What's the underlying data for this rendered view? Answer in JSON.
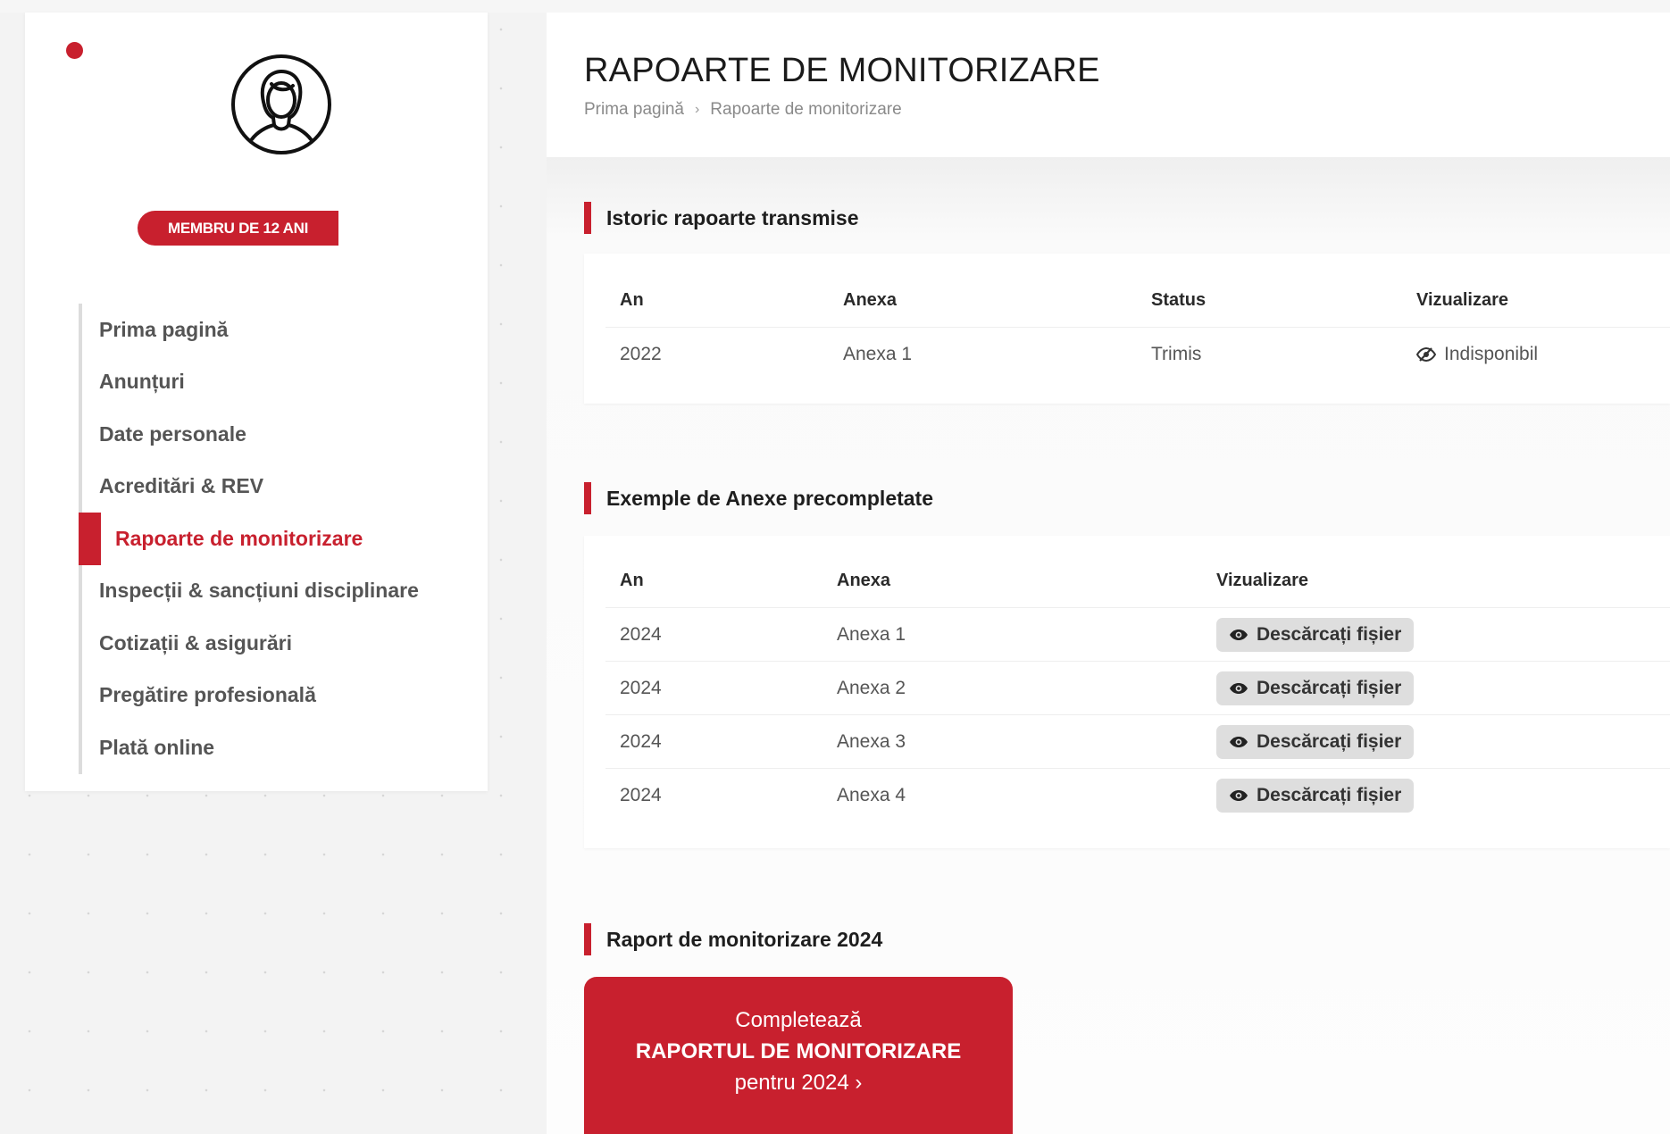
{
  "sidebar": {
    "badge": "MEMBRU DE 12 ANI",
    "items": [
      {
        "label": "Prima pagină",
        "active": false
      },
      {
        "label": "Anunțuri",
        "active": false
      },
      {
        "label": "Date personale",
        "active": false
      },
      {
        "label": "Acreditări & REV",
        "active": false
      },
      {
        "label": "Rapoarte de monitorizare",
        "active": true
      },
      {
        "label": "Inspecții & sancțiuni disciplinare",
        "active": false
      },
      {
        "label": "Cotizații & asigurări",
        "active": false
      },
      {
        "label": "Pregătire profesională",
        "active": false
      },
      {
        "label": "Plată online",
        "active": false
      }
    ]
  },
  "header": {
    "title": "RAPOARTE DE MONITORIZARE",
    "breadcrumb": [
      "Prima pagină",
      "Rapoarte de monitorizare"
    ],
    "breadcrumb_sep": "›"
  },
  "history": {
    "title": "Istoric rapoarte transmise",
    "columns": [
      "An",
      "Anexa",
      "Status",
      "Vizualizare"
    ],
    "rows": [
      {
        "year": "2022",
        "annex": "Anexa 1",
        "status": "Trimis",
        "view": "Indisponibil"
      }
    ]
  },
  "examples": {
    "title": "Exemple de Anexe precompletate",
    "columns": [
      "An",
      "Anexa",
      "Vizualizare"
    ],
    "rows": [
      {
        "year": "2024",
        "annex": "Anexa 1",
        "button": "Descărcați fișier"
      },
      {
        "year": "2024",
        "annex": "Anexa 2",
        "button": "Descărcați fișier"
      },
      {
        "year": "2024",
        "annex": "Anexa 3",
        "button": "Descărcați fișier"
      },
      {
        "year": "2024",
        "annex": "Anexa 4",
        "button": "Descărcați fișier"
      }
    ]
  },
  "report": {
    "title": "Raport de monitorizare 2024",
    "cta_line1": "Completează",
    "cta_line2": "RAPORTUL DE MONITORIZARE",
    "cta_line3": "pentru 2024 ›"
  },
  "colors": {
    "accent": "#c8202e",
    "nav_border": "#dcdcdc",
    "button_bg": "#dedede"
  }
}
